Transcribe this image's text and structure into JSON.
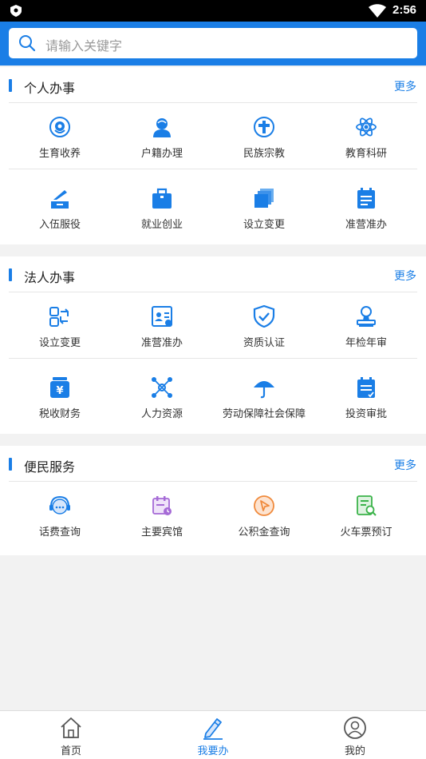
{
  "status_bar": {
    "time": "2:56"
  },
  "search": {
    "placeholder": "请输入关键字"
  },
  "colors": {
    "accent": "#1a7ee6",
    "orange": "#f08a3c",
    "green": "#3bb34a",
    "purple": "#a56ad6"
  },
  "sections": [
    {
      "title": "个人办事",
      "more": "更多",
      "items": [
        {
          "label": "生育收养",
          "icon": "baby-icon"
        },
        {
          "label": "户籍办理",
          "icon": "person-icon"
        },
        {
          "label": "民族宗教",
          "icon": "cross-circle-icon"
        },
        {
          "label": "教育科研",
          "icon": "atom-icon"
        },
        {
          "label": "入伍服役",
          "icon": "military-icon"
        },
        {
          "label": "就业创业",
          "icon": "briefcase-icon"
        },
        {
          "label": "设立变更",
          "icon": "stack-icon"
        },
        {
          "label": "准营准办",
          "icon": "document-icon"
        }
      ]
    },
    {
      "title": "法人办事",
      "more": "更多",
      "items": [
        {
          "label": "设立变更",
          "icon": "swap-icon"
        },
        {
          "label": "准营准办",
          "icon": "id-card-icon"
        },
        {
          "label": "资质认证",
          "icon": "shield-check-icon"
        },
        {
          "label": "年检年审",
          "icon": "stamp-icon"
        },
        {
          "label": "税收财务",
          "icon": "yuan-icon"
        },
        {
          "label": "人力资源",
          "icon": "network-icon"
        },
        {
          "label": "劳动保障社会保障",
          "icon": "umbrella-icon"
        },
        {
          "label": "投资审批",
          "icon": "approval-doc-icon"
        }
      ]
    },
    {
      "title": "便民服务",
      "more": "更多",
      "items": [
        {
          "label": "话费查询",
          "icon": "headset-icon"
        },
        {
          "label": "主要宾馆",
          "icon": "calendar-icon"
        },
        {
          "label": "公积金查询",
          "icon": "cursor-circle-icon"
        },
        {
          "label": "火车票预订",
          "icon": "ticket-search-icon"
        }
      ]
    }
  ],
  "tabs": [
    {
      "label": "首页",
      "icon": "home-icon",
      "active": false
    },
    {
      "label": "我要办",
      "icon": "pencil-icon",
      "active": true
    },
    {
      "label": "我的",
      "icon": "user-icon",
      "active": false
    }
  ]
}
